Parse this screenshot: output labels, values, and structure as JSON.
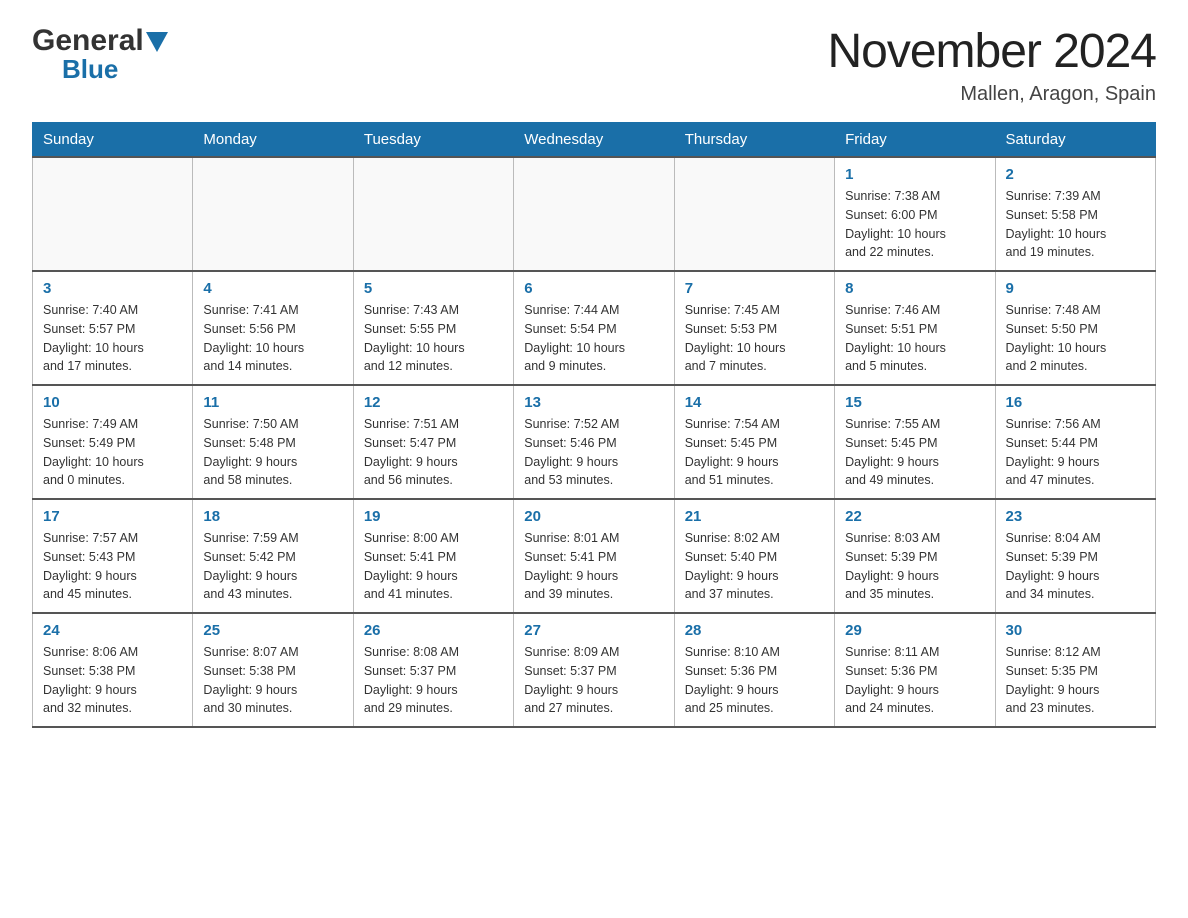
{
  "header": {
    "logo": {
      "general": "General",
      "blue": "Blue",
      "triangle_color": "#1a6fa8"
    },
    "title": "November 2024",
    "location": "Mallen, Aragon, Spain"
  },
  "calendar": {
    "days_of_week": [
      "Sunday",
      "Monday",
      "Tuesday",
      "Wednesday",
      "Thursday",
      "Friday",
      "Saturday"
    ],
    "weeks": [
      [
        {
          "day": "",
          "info": ""
        },
        {
          "day": "",
          "info": ""
        },
        {
          "day": "",
          "info": ""
        },
        {
          "day": "",
          "info": ""
        },
        {
          "day": "",
          "info": ""
        },
        {
          "day": "1",
          "info": "Sunrise: 7:38 AM\nSunset: 6:00 PM\nDaylight: 10 hours\nand 22 minutes."
        },
        {
          "day": "2",
          "info": "Sunrise: 7:39 AM\nSunset: 5:58 PM\nDaylight: 10 hours\nand 19 minutes."
        }
      ],
      [
        {
          "day": "3",
          "info": "Sunrise: 7:40 AM\nSunset: 5:57 PM\nDaylight: 10 hours\nand 17 minutes."
        },
        {
          "day": "4",
          "info": "Sunrise: 7:41 AM\nSunset: 5:56 PM\nDaylight: 10 hours\nand 14 minutes."
        },
        {
          "day": "5",
          "info": "Sunrise: 7:43 AM\nSunset: 5:55 PM\nDaylight: 10 hours\nand 12 minutes."
        },
        {
          "day": "6",
          "info": "Sunrise: 7:44 AM\nSunset: 5:54 PM\nDaylight: 10 hours\nand 9 minutes."
        },
        {
          "day": "7",
          "info": "Sunrise: 7:45 AM\nSunset: 5:53 PM\nDaylight: 10 hours\nand 7 minutes."
        },
        {
          "day": "8",
          "info": "Sunrise: 7:46 AM\nSunset: 5:51 PM\nDaylight: 10 hours\nand 5 minutes."
        },
        {
          "day": "9",
          "info": "Sunrise: 7:48 AM\nSunset: 5:50 PM\nDaylight: 10 hours\nand 2 minutes."
        }
      ],
      [
        {
          "day": "10",
          "info": "Sunrise: 7:49 AM\nSunset: 5:49 PM\nDaylight: 10 hours\nand 0 minutes."
        },
        {
          "day": "11",
          "info": "Sunrise: 7:50 AM\nSunset: 5:48 PM\nDaylight: 9 hours\nand 58 minutes."
        },
        {
          "day": "12",
          "info": "Sunrise: 7:51 AM\nSunset: 5:47 PM\nDaylight: 9 hours\nand 56 minutes."
        },
        {
          "day": "13",
          "info": "Sunrise: 7:52 AM\nSunset: 5:46 PM\nDaylight: 9 hours\nand 53 minutes."
        },
        {
          "day": "14",
          "info": "Sunrise: 7:54 AM\nSunset: 5:45 PM\nDaylight: 9 hours\nand 51 minutes."
        },
        {
          "day": "15",
          "info": "Sunrise: 7:55 AM\nSunset: 5:45 PM\nDaylight: 9 hours\nand 49 minutes."
        },
        {
          "day": "16",
          "info": "Sunrise: 7:56 AM\nSunset: 5:44 PM\nDaylight: 9 hours\nand 47 minutes."
        }
      ],
      [
        {
          "day": "17",
          "info": "Sunrise: 7:57 AM\nSunset: 5:43 PM\nDaylight: 9 hours\nand 45 minutes."
        },
        {
          "day": "18",
          "info": "Sunrise: 7:59 AM\nSunset: 5:42 PM\nDaylight: 9 hours\nand 43 minutes."
        },
        {
          "day": "19",
          "info": "Sunrise: 8:00 AM\nSunset: 5:41 PM\nDaylight: 9 hours\nand 41 minutes."
        },
        {
          "day": "20",
          "info": "Sunrise: 8:01 AM\nSunset: 5:41 PM\nDaylight: 9 hours\nand 39 minutes."
        },
        {
          "day": "21",
          "info": "Sunrise: 8:02 AM\nSunset: 5:40 PM\nDaylight: 9 hours\nand 37 minutes."
        },
        {
          "day": "22",
          "info": "Sunrise: 8:03 AM\nSunset: 5:39 PM\nDaylight: 9 hours\nand 35 minutes."
        },
        {
          "day": "23",
          "info": "Sunrise: 8:04 AM\nSunset: 5:39 PM\nDaylight: 9 hours\nand 34 minutes."
        }
      ],
      [
        {
          "day": "24",
          "info": "Sunrise: 8:06 AM\nSunset: 5:38 PM\nDaylight: 9 hours\nand 32 minutes."
        },
        {
          "day": "25",
          "info": "Sunrise: 8:07 AM\nSunset: 5:38 PM\nDaylight: 9 hours\nand 30 minutes."
        },
        {
          "day": "26",
          "info": "Sunrise: 8:08 AM\nSunset: 5:37 PM\nDaylight: 9 hours\nand 29 minutes."
        },
        {
          "day": "27",
          "info": "Sunrise: 8:09 AM\nSunset: 5:37 PM\nDaylight: 9 hours\nand 27 minutes."
        },
        {
          "day": "28",
          "info": "Sunrise: 8:10 AM\nSunset: 5:36 PM\nDaylight: 9 hours\nand 25 minutes."
        },
        {
          "day": "29",
          "info": "Sunrise: 8:11 AM\nSunset: 5:36 PM\nDaylight: 9 hours\nand 24 minutes."
        },
        {
          "day": "30",
          "info": "Sunrise: 8:12 AM\nSunset: 5:35 PM\nDaylight: 9 hours\nand 23 minutes."
        }
      ]
    ]
  }
}
